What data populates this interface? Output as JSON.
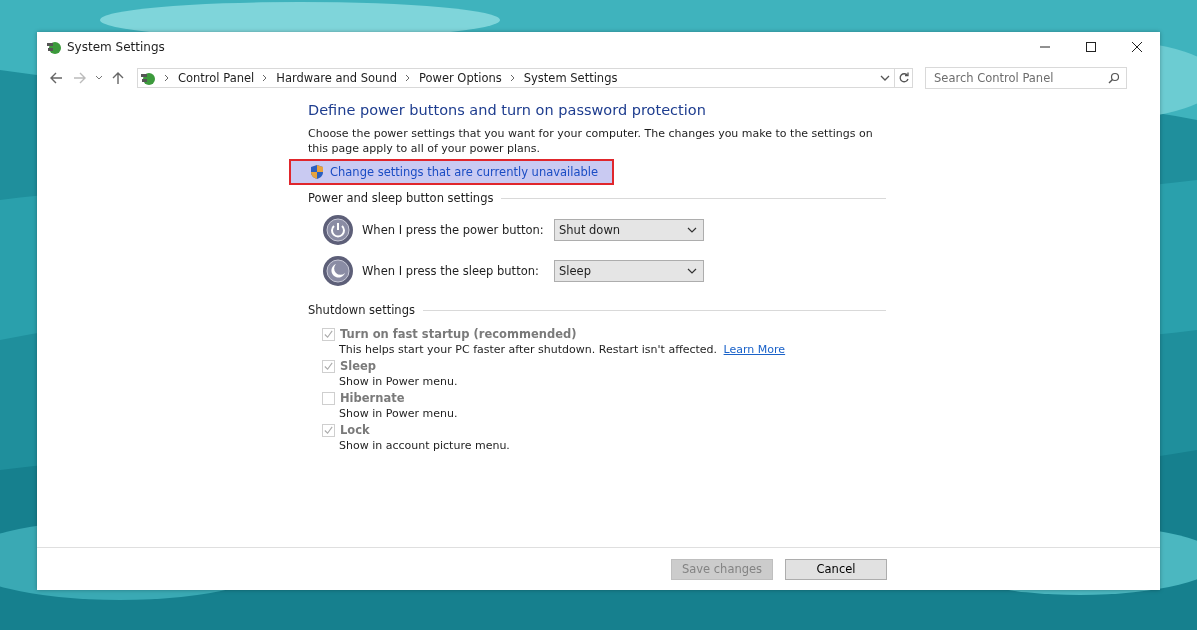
{
  "window": {
    "title": "System Settings"
  },
  "address_bar": {
    "breadcrumbs": [
      "Control Panel",
      "Hardware and Sound",
      "Power Options",
      "System Settings"
    ]
  },
  "search": {
    "placeholder": "Search Control Panel"
  },
  "heading": "Define power buttons and turn on password protection",
  "description": "Choose the power settings that you want for your computer. The changes you make to the settings on this page apply to all of your power plans.",
  "admin_link": {
    "label": "Change settings that are currently unavailable",
    "highlighted": true
  },
  "power_section": {
    "title": "Power and sleep button settings",
    "rows": [
      {
        "kind": "power",
        "label": "When I press the power button:",
        "value": "Shut down"
      },
      {
        "kind": "sleep",
        "label": "When I press the sleep button:",
        "value": "Sleep"
      }
    ]
  },
  "shutdown_section": {
    "title": "Shutdown settings",
    "options": [
      {
        "label": "Turn on fast startup (recommended)",
        "checked": true,
        "disabled": true,
        "description": "This helps start your PC faster after shutdown. Restart isn't affected.",
        "link": "Learn More"
      },
      {
        "label": "Sleep",
        "checked": true,
        "disabled": true,
        "description": "Show in Power menu."
      },
      {
        "label": "Hibernate",
        "checked": false,
        "disabled": true,
        "description": "Show in Power menu."
      },
      {
        "label": "Lock",
        "checked": true,
        "disabled": true,
        "description": "Show in account picture menu."
      }
    ]
  },
  "buttons": [
    {
      "label": "Save changes",
      "disabled": true
    },
    {
      "label": "Cancel",
      "disabled": false
    }
  ]
}
